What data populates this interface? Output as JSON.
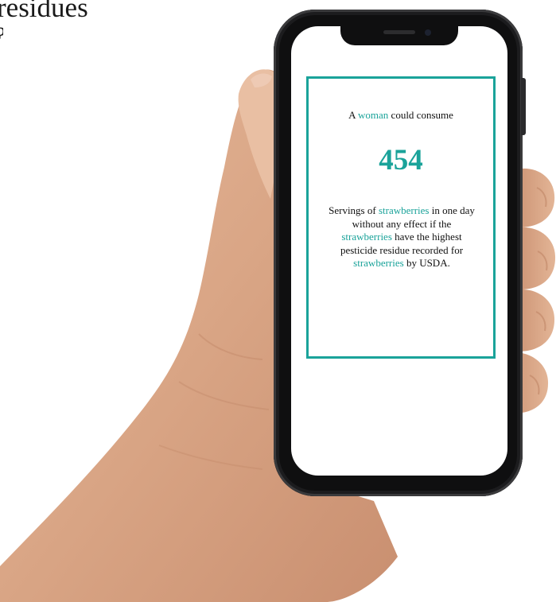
{
  "heading": {
    "line1": "residues",
    "line2": "?"
  },
  "card": {
    "intro": {
      "before": "A ",
      "person": "woman",
      "after": " could consume"
    },
    "number": "454",
    "details": {
      "p1": "Servings of ",
      "food1": "strawberries",
      "p2": " in one day without any effect if the ",
      "food2": "strawberries",
      "p3": " have the highest pesticide residue recorded for ",
      "food3": "strawberries",
      "p4": " by USDA."
    }
  },
  "colors": {
    "accent": "#1aa39a",
    "text": "#111111",
    "phone_frame": "#0f0f10",
    "skin": "#d9a98a"
  },
  "icons": {
    "hand": "hand-image",
    "phone": "smartphone"
  }
}
